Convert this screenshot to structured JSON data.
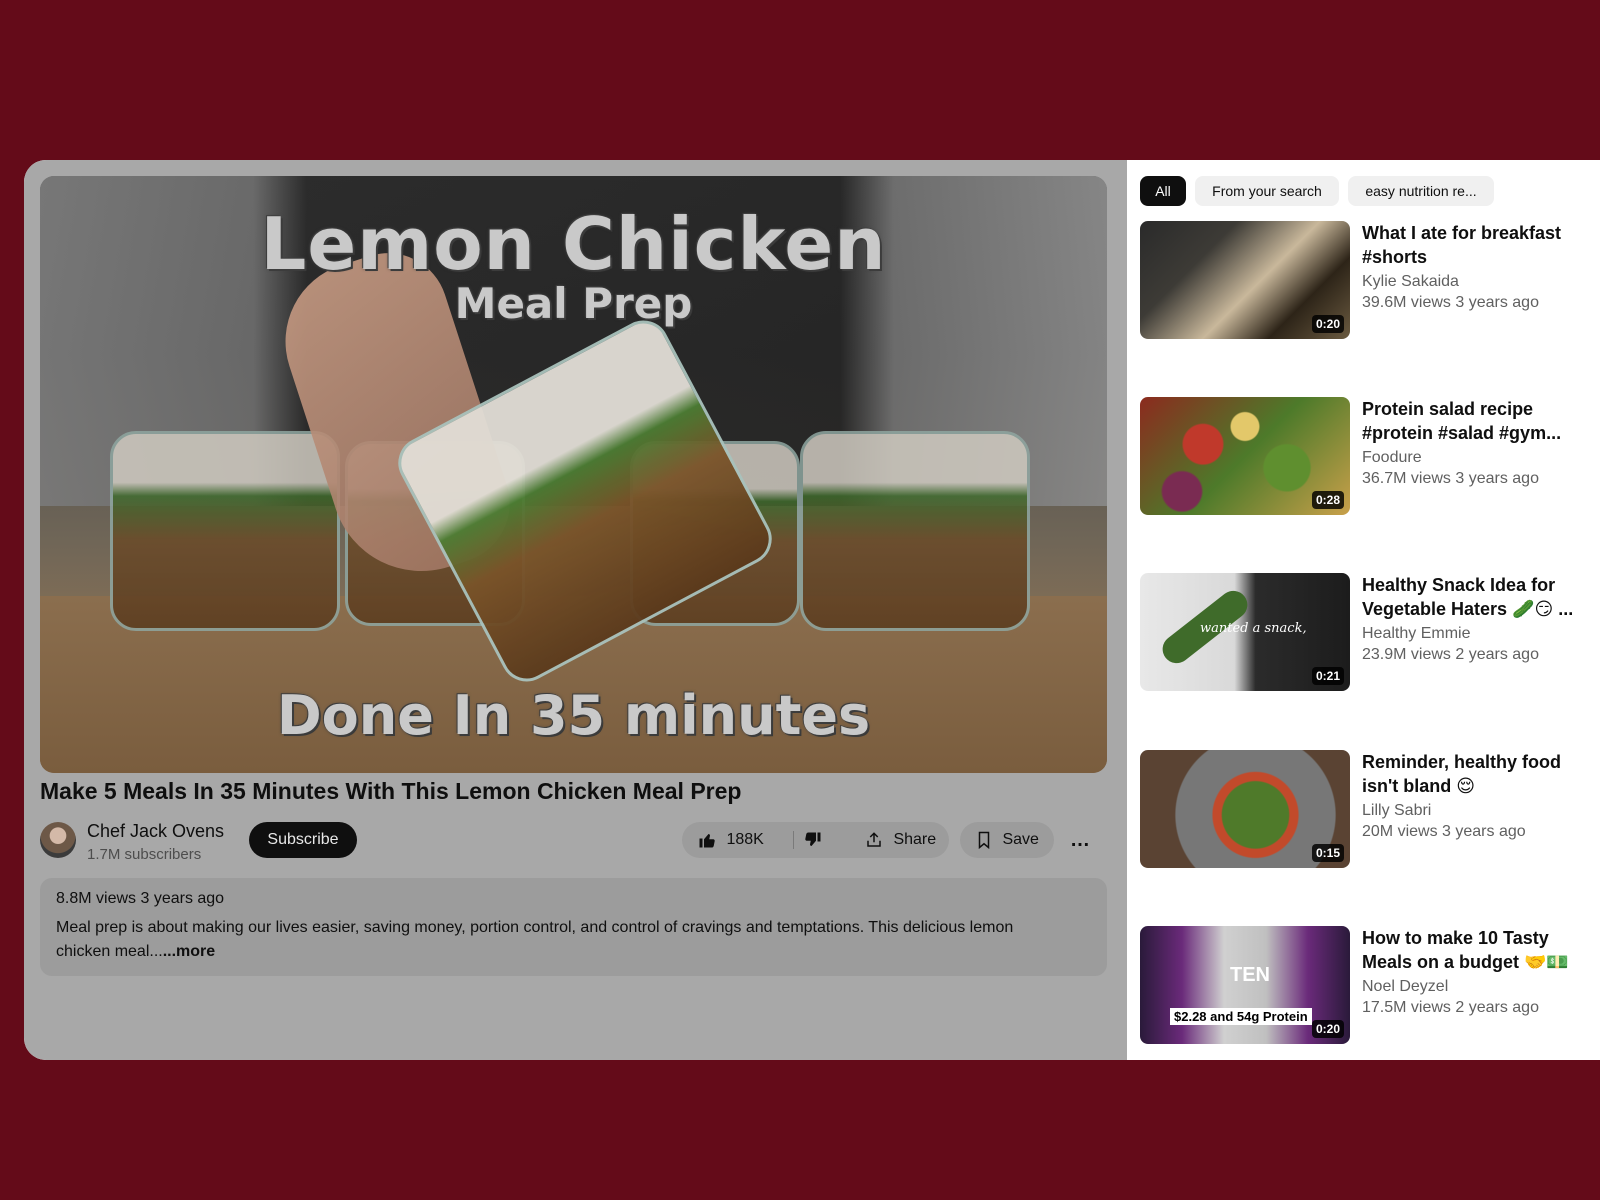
{
  "player": {
    "overlay_title": "Lemon Chicken",
    "overlay_subtitle": "Meal Prep",
    "overlay_bottom": "Done In 35 minutes"
  },
  "video": {
    "title": "Make 5 Meals In 35 Minutes With This Lemon Chicken Meal Prep",
    "channel": "Chef Jack Ovens",
    "subscribers": "1.7M subscribers",
    "subscribe_label": "Subscribe",
    "likes": "188K",
    "share_label": "Share",
    "save_label": "Save",
    "more_icon": "…"
  },
  "description": {
    "meta": "8.8M views 3 years ago",
    "text": "Meal prep is about making our lives easier, saving money, portion control, and control of cravings and temptations. This delicious lemon chicken meal...",
    "more_label": "...more"
  },
  "chips": [
    {
      "label": "All",
      "active": true
    },
    {
      "label": "From your search",
      "active": false
    },
    {
      "label": "easy nutrition re...",
      "active": false
    }
  ],
  "recommendations": [
    {
      "title": "What I ate for breakfast #shorts",
      "channel": "Kylie Sakaida",
      "meta": "39.6M views 3 years ago",
      "duration": "0:20"
    },
    {
      "title": "Protein salad recipe #protein #salad #gym...",
      "channel": "Foodure",
      "meta": "36.7M views 3 years ago",
      "duration": "0:28"
    },
    {
      "title": "Healthy Snack Idea for Vegetable Haters 🥒😏 ...",
      "channel": "Healthy Emmie",
      "meta": "23.9M views 2 years ago",
      "duration": "0:21",
      "thumb_text": "wanted a snack,"
    },
    {
      "title": "Reminder, healthy food isn't bland 😌",
      "channel": "Lilly Sabri",
      "meta": "20M views 3 years ago",
      "duration": "0:15"
    },
    {
      "title": "How to make 10 Tasty Meals on a budget 🤝💵",
      "channel": "Noel Deyzel",
      "meta": "17.5M views 2 years ago",
      "duration": "0:20",
      "thumb_text": "TEN",
      "thumb_caption": "$2.28 and 54g Protein"
    }
  ],
  "colors": {
    "background": "#640b19",
    "dimmed_panel": "#a8a8a8",
    "button_dark": "#0f0f0f"
  }
}
